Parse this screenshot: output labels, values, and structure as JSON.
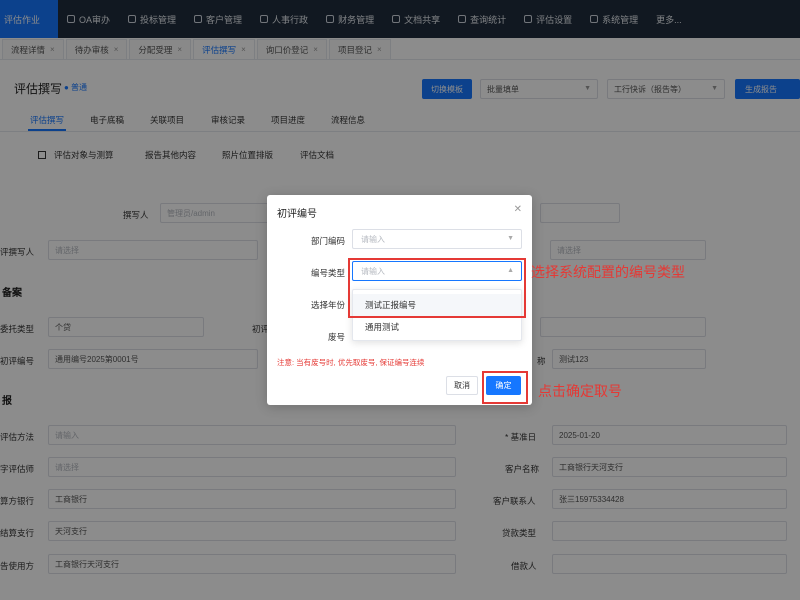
{
  "topnav": {
    "brand": "评估作业",
    "items": [
      {
        "label": "OA审办",
        "icon": "globe-icon"
      },
      {
        "label": "投标管理",
        "icon": "monitor-icon"
      },
      {
        "label": "客户管理",
        "icon": "user-icon"
      },
      {
        "label": "人事行政",
        "icon": "id-card-icon"
      },
      {
        "label": "财务管理",
        "icon": "finance-icon"
      },
      {
        "label": "文档共享",
        "icon": "document-icon"
      },
      {
        "label": "查询统计",
        "icon": "check-icon"
      },
      {
        "label": "评估设置",
        "icon": "grid-icon"
      },
      {
        "label": "系统管理",
        "icon": "gear-icon"
      },
      {
        "label": "更多...",
        "icon": ""
      }
    ]
  },
  "tabs": [
    {
      "label": "流程详情"
    },
    {
      "label": "待办审核"
    },
    {
      "label": "分配受理"
    },
    {
      "label": "评估撰写"
    },
    {
      "label": "询口价登记"
    },
    {
      "label": "项目登记"
    }
  ],
  "header": {
    "title": "评估撰写",
    "badge": "● 普通",
    "switch_template": "切换模板",
    "batch_fill": "批量填单",
    "workflow": "工行快诉（报告等）",
    "generate": "生成报告"
  },
  "subtabs": [
    "评估撰写",
    "电子底稿",
    "关联项目",
    "审核记录",
    "项目进度",
    "流程信息"
  ],
  "subtabs2": [
    "评估对象与测算",
    "报告其他内容",
    "照片位置排版",
    "评估文档"
  ],
  "form": {
    "writer_label": "撰写人",
    "writer_value": "管理员/admin",
    "first_writer_label": "评撰写人",
    "first_writer_placeholder": "请选择",
    "section_case": "备案",
    "commission_type_label": "委托类型",
    "commission_type_value": "个贷",
    "initial_label": "初评",
    "initial_no_label": "初评编号",
    "initial_no_value": "通用编号2025第0001号",
    "name_label": "称",
    "name_value": "测试123",
    "section_report": "报",
    "method_label": "评估方法",
    "method_placeholder": "请输入",
    "valuer_label": "字评估师",
    "valuer_placeholder": "请选择",
    "base_date_label": "* 基准日",
    "base_date_value": "2025-01-20",
    "settle_bank_label": "算方银行",
    "settle_bank_value": "工商银行",
    "customer_name_label": "客户名称",
    "customer_name_value": "工商银行天河支行",
    "settle_branch_label": "结算支行",
    "settle_branch_value": "天河支行",
    "customer_contact_label": "客户联系人",
    "customer_contact_value": "张三15975334428",
    "loan_type_label": "贷款类型",
    "report_user_label": "告使用方",
    "report_user_value": "工商银行天河支行",
    "borrower_label": "借款人"
  },
  "dialog": {
    "title": "初评编号",
    "dept_label": "部门编码",
    "dept_placeholder": "请输入",
    "type_label": "编号类型",
    "type_placeholder": "请输入",
    "year_label": "选择年份",
    "seq_label": "废号",
    "options": [
      "测试正报编号",
      "通用测试"
    ],
    "note": "注意: 当有废号时, 优先取废号, 保证编号连续",
    "cancel": "取消",
    "confirm": "确定"
  },
  "annotations": {
    "select_type": "选择系统配置的编号类型",
    "click_confirm": "点击确定取号",
    "color": "#e53935"
  },
  "colors": {
    "accent": "#1677ff",
    "nav_bg": "#1f2d3d"
  }
}
